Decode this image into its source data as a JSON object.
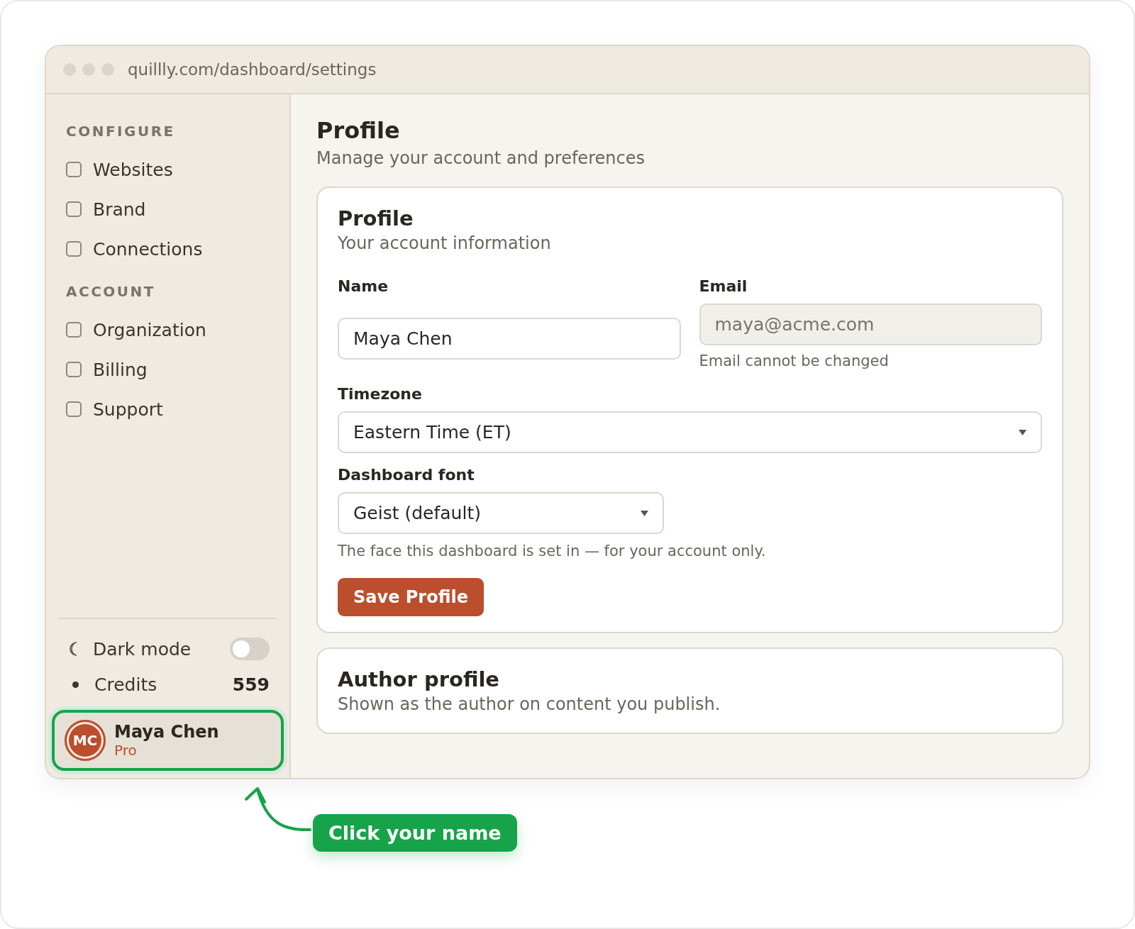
{
  "browser": {
    "url": "quillly.com/dashboard/settings"
  },
  "sidebar": {
    "sections": [
      {
        "heading": "CONFIGURE",
        "items": [
          {
            "label": "Websites"
          },
          {
            "label": "Brand"
          },
          {
            "label": "Connections"
          }
        ]
      },
      {
        "heading": "ACCOUNT",
        "items": [
          {
            "label": "Organization"
          },
          {
            "label": "Billing"
          },
          {
            "label": "Support"
          }
        ]
      }
    ],
    "dark_mode": {
      "label": "Dark mode",
      "on": false
    },
    "credits": {
      "label": "Credits",
      "value": "559"
    },
    "user": {
      "initials": "MC",
      "name": "Maya Chen",
      "plan": "Pro"
    }
  },
  "page": {
    "title": "Profile",
    "subtitle": "Manage your account and preferences"
  },
  "profile_card": {
    "title": "Profile",
    "subtitle": "Your account information",
    "name": {
      "label": "Name",
      "value": "Maya Chen"
    },
    "email": {
      "label": "Email",
      "value": "maya@acme.com",
      "disabled": true,
      "hint": "Email cannot be changed"
    },
    "timezone": {
      "label": "Timezone",
      "value": "Eastern Time (ET)"
    },
    "font": {
      "label": "Dashboard font",
      "value": "Geist (default)",
      "hint": "The face this dashboard is set in — for your account only."
    },
    "save_button": "Save Profile"
  },
  "author_card": {
    "title": "Author profile",
    "subtitle": "Shown as the author on content you publish."
  },
  "callout": {
    "text": "Click your name"
  }
}
